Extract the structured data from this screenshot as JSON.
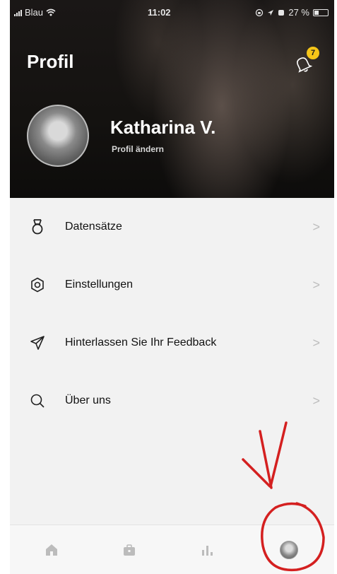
{
  "status_bar": {
    "carrier": "Blau",
    "time": "11:02",
    "battery": "27 %"
  },
  "header": {
    "title": "Profil",
    "notification_count": "7",
    "user_name": "Katharina V.",
    "edit_profile_label": "Profil ändern"
  },
  "menu": {
    "items": [
      {
        "label": "Datensätze",
        "icon": "medal-icon"
      },
      {
        "label": "Einstellungen",
        "icon": "settings-gear-icon"
      },
      {
        "label": "Hinterlassen Sie Ihr Feedback",
        "icon": "send-icon"
      },
      {
        "label": "Über uns",
        "icon": "search-icon"
      }
    ],
    "chevron": ">"
  },
  "tabbar": {
    "tabs": [
      "home-icon",
      "briefcase-icon",
      "bar-chart-icon",
      "profile-avatar"
    ]
  },
  "colors": {
    "badge": "#f5c518",
    "annotation": "#d42020",
    "background": "#f2f2f2"
  }
}
